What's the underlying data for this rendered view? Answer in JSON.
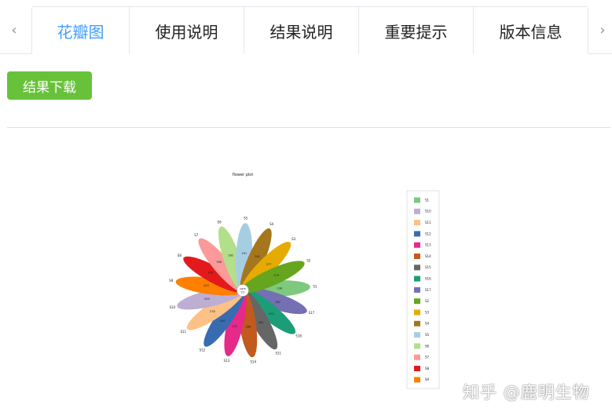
{
  "tabs": {
    "left_arrow": "‹",
    "right_arrow": "›",
    "items": [
      {
        "label": "花瓣图",
        "active": true
      },
      {
        "label": "使用说明",
        "active": false
      },
      {
        "label": "结果说明",
        "active": false
      },
      {
        "label": "重要提示",
        "active": false
      },
      {
        "label": "版本信息",
        "active": false
      }
    ]
  },
  "toolbar": {
    "download_label": "结果下载"
  },
  "chart_data": {
    "type": "flower",
    "title": "flower plot",
    "core_label": "core",
    "core_value": "15",
    "petals": [
      {
        "name": "S1",
        "value": "238",
        "color": "#7fc97f"
      },
      {
        "name": "S17",
        "value": "361",
        "color": "#7570b3"
      },
      {
        "name": "S18",
        "value": "412",
        "color": "#1b9e77"
      },
      {
        "name": "S11",
        "value": "461",
        "color": "#666666"
      },
      {
        "name": "S14",
        "value": "288",
        "color": "#c15a1c"
      },
      {
        "name": "S13",
        "value": "170",
        "color": "#e7298a"
      },
      {
        "name": "S12",
        "value": "184",
        "color": "#386cb0"
      },
      {
        "name": "S11",
        "value": "278",
        "color": "#fdc086"
      },
      {
        "name": "S10",
        "value": "209",
        "color": "#beaed4"
      },
      {
        "name": "S9",
        "value": "249",
        "color": "#ff7f00"
      },
      {
        "name": "S8",
        "value": "308",
        "color": "#e31a1c"
      },
      {
        "name": "S7",
        "value": "358",
        "color": "#fb9a99"
      },
      {
        "name": "S6",
        "value": "282",
        "color": "#b2df8a"
      },
      {
        "name": "S5",
        "value": "291",
        "color": "#a6cee3"
      },
      {
        "name": "S4",
        "value": "281",
        "color": "#a6761d"
      },
      {
        "name": "S3",
        "value": "277",
        "color": "#e6ab02"
      },
      {
        "name": "S2",
        "value": "279",
        "color": "#66a61e"
      }
    ],
    "legend": [
      {
        "name": "S1",
        "color": "#7fc97f"
      },
      {
        "name": "S10",
        "color": "#beaed4"
      },
      {
        "name": "S11",
        "color": "#fdc086"
      },
      {
        "name": "S12",
        "color": "#386cb0"
      },
      {
        "name": "S13",
        "color": "#e7298a"
      },
      {
        "name": "S14",
        "color": "#c15a1c"
      },
      {
        "name": "S15",
        "color": "#666666"
      },
      {
        "name": "S16",
        "color": "#1b9e77"
      },
      {
        "name": "S17",
        "color": "#7570b3"
      },
      {
        "name": "S2",
        "color": "#66a61e"
      },
      {
        "name": "S3",
        "color": "#e6ab02"
      },
      {
        "name": "S4",
        "color": "#a6761d"
      },
      {
        "name": "S5",
        "color": "#a6cee3"
      },
      {
        "name": "S6",
        "color": "#b2df8a"
      },
      {
        "name": "S7",
        "color": "#fb9a99"
      },
      {
        "name": "S8",
        "color": "#e31a1c"
      },
      {
        "name": "S9",
        "color": "#ff7f00"
      }
    ],
    "legend_position": "right"
  },
  "watermark": "知乎 @鹿明生物"
}
